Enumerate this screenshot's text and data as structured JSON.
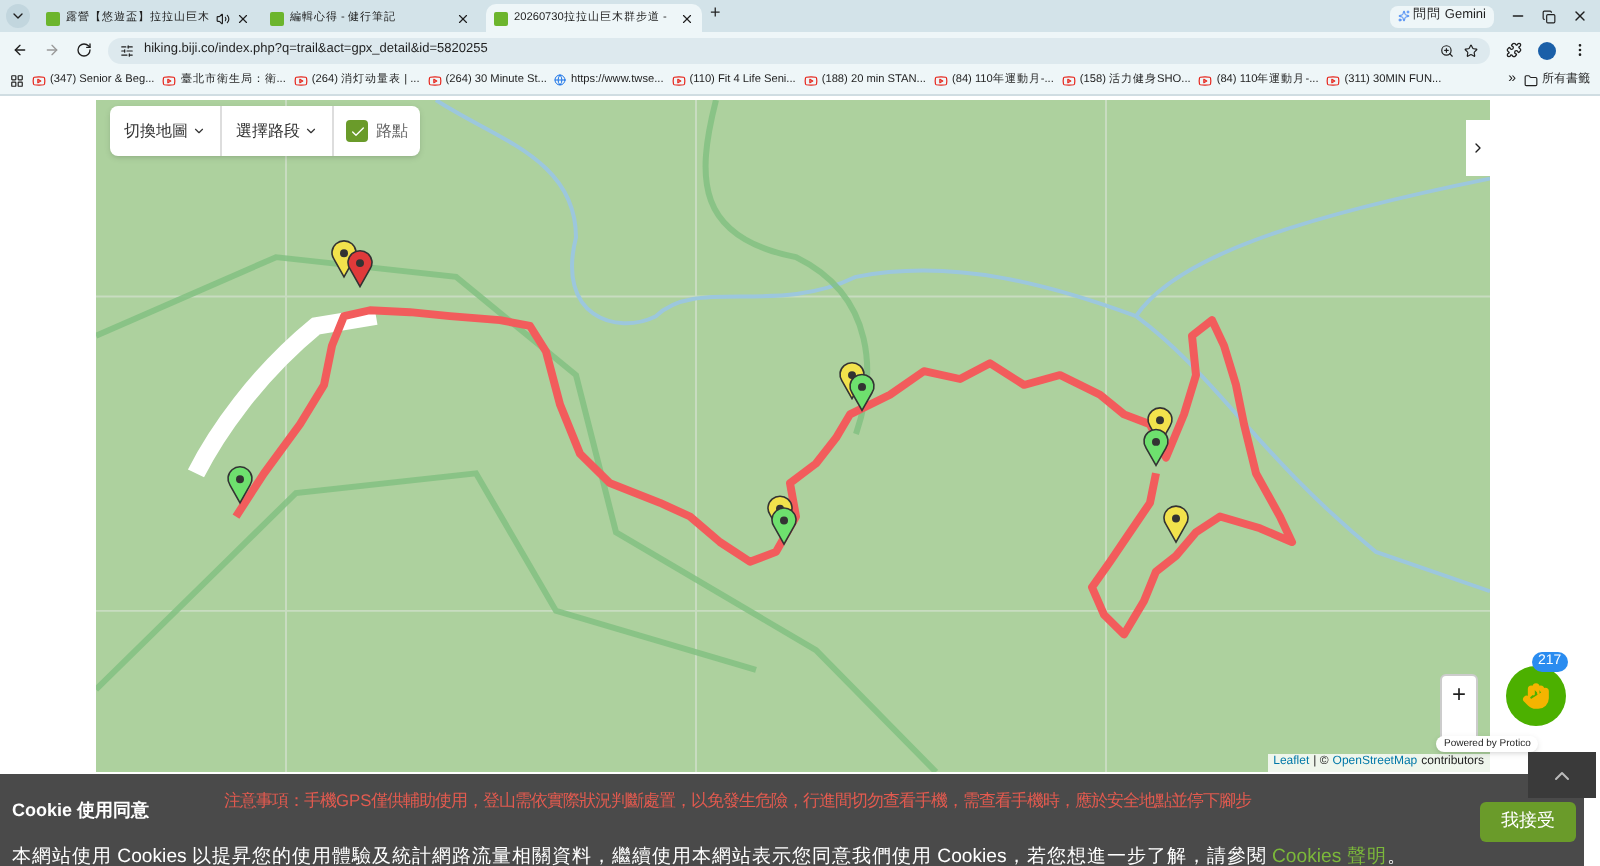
{
  "browser": {
    "tabs": [
      {
        "title": "露營【悠遊盃】拉拉山巨木",
        "selected": false,
        "audio": true
      },
      {
        "title": "編輯心得 - 健行筆記",
        "selected": false,
        "audio": false
      },
      {
        "title": "20260730拉拉山巨木群步道 -",
        "selected": true,
        "audio": false
      }
    ],
    "new_tab": "+",
    "gemini": "問問 Gemini",
    "url": "hiking.biji.co/index.php?q=trail&act=gpx_detail&id=5820255",
    "bookmarks": [
      {
        "title": "(347) Senior & Beg...",
        "kind": "video"
      },
      {
        "title": "臺北市衛生局：衛...",
        "kind": "video"
      },
      {
        "title": "(264) 消灯动量表 | ...",
        "kind": "video"
      },
      {
        "title": "(264) 30 Minute St...",
        "kind": "video"
      },
      {
        "title": "https://www.twse...",
        "kind": "web"
      },
      {
        "title": "(110) Fit 4 Life Seni...",
        "kind": "video"
      },
      {
        "title": "(188) 20 min STAN...",
        "kind": "video"
      },
      {
        "title": "(84) 110年運動月-...",
        "kind": "video"
      },
      {
        "title": "(158) 活力健身SHO...",
        "kind": "video"
      },
      {
        "title": "(84) 110年運動月-...",
        "kind": "video"
      },
      {
        "title": "(311) 30MIN FUN...",
        "kind": "video"
      }
    ],
    "more": "»",
    "all_bookmarks": "所有書籤"
  },
  "map": {
    "switch_map": "切換地圖",
    "select_segment": "選擇路段",
    "waypoints": {
      "label": "路點",
      "checked": true
    },
    "zoom_in": "+",
    "attribution": {
      "leaflet": "Leaflet",
      "middle": "| ©",
      "osm": "OpenStreetMap",
      "suffix": "contributors"
    }
  },
  "notice": "注意事項：手機GPS僅供輔助使用，登山需依實際狀況判斷處置，以免發生危險，行進間切勿查看手機，需查看手機時，應於安全地點並停下腳步",
  "chat_widget": {
    "badge": "217",
    "powered_by": "Powered by Protico"
  },
  "cookie_banner": {
    "title": "Cookie 使用同意",
    "text": "本網站使用 Cookies 以提昇您的使用體驗及統計網路流量相關資料，繼續使用本網站表示您同意我們使用 Cookies，若您想進一步了解，請參閱",
    "link": "Cookies 聲明",
    "end": "。",
    "accept": "我接受"
  }
}
